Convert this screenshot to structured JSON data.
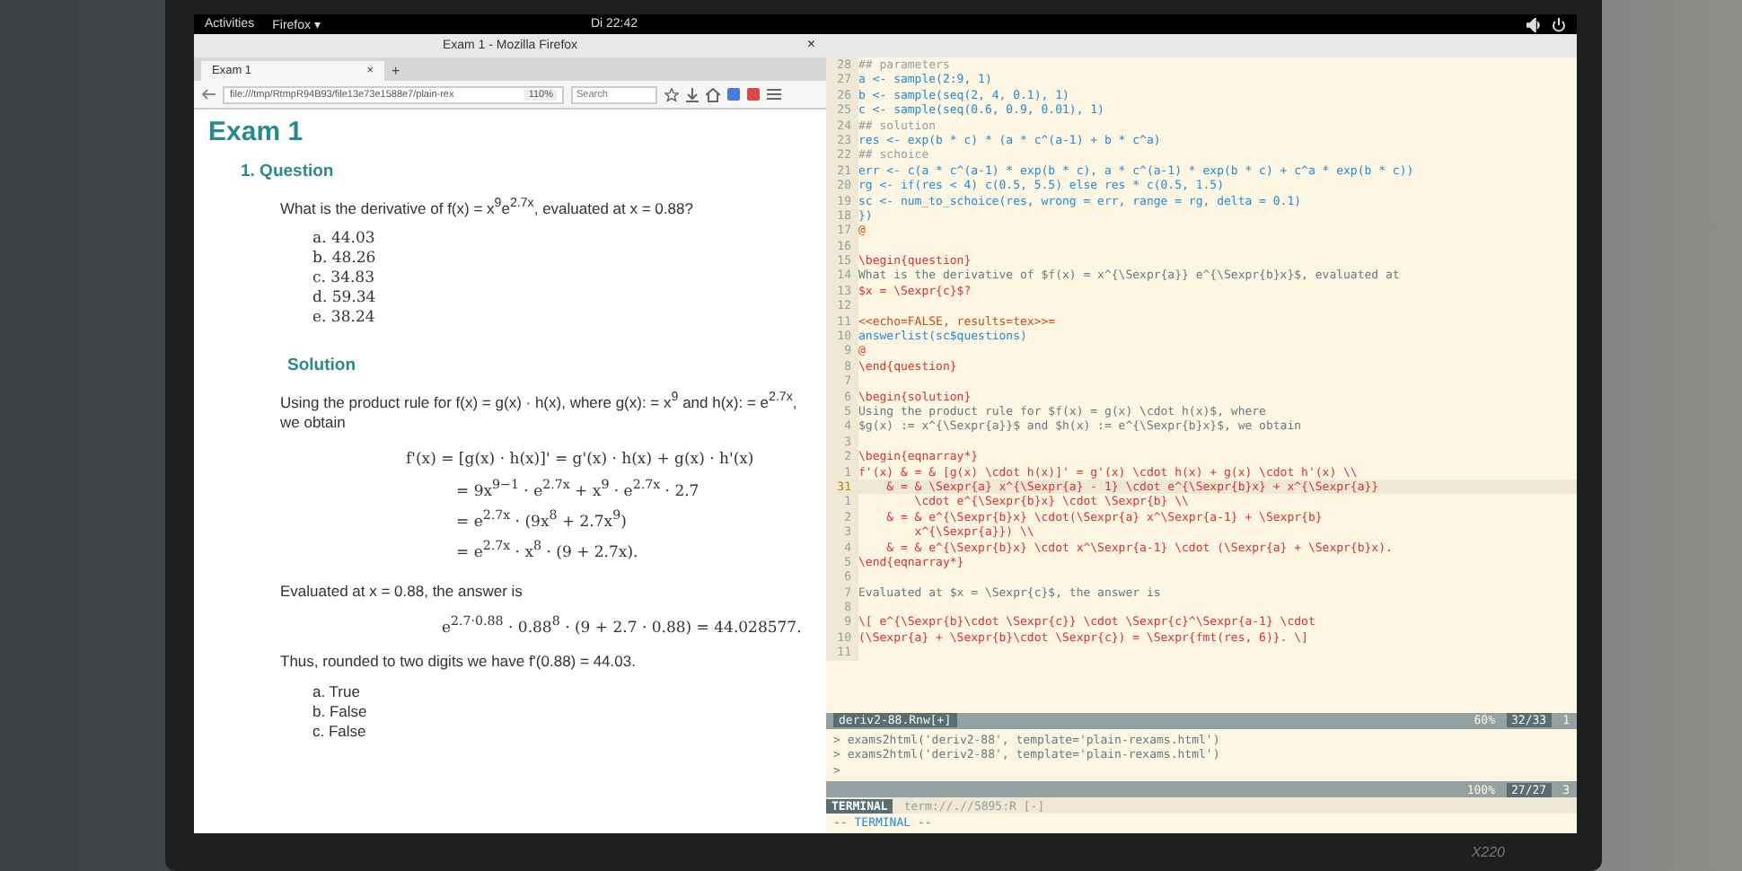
{
  "top_bar": {
    "activities": "Activities",
    "app": "Firefox ▾",
    "clock": "Di 22:42"
  },
  "browser": {
    "title": "Exam 1 - Mozilla Firefox",
    "close": "×",
    "tabs": [
      {
        "label": "Exam 1",
        "selected": true
      }
    ],
    "tab_close": "×",
    "new_tab": "+",
    "url": "file:///tmp/RtmpR94B93/file13e73e1588e7/plain-rex",
    "zoom": "110%",
    "search": {
      "placeholder": "Search"
    }
  },
  "page": {
    "title": "Exam 1",
    "question_heading": "1. Question",
    "question": "What is the derivative of f(x) = x$^{9}$e$^{2.7x}$, evaluated at x = 0.88?",
    "answers": [
      "a. 44.03",
      "b. 48.26",
      "c. 34.83",
      "d. 59.34",
      "e. 38.24"
    ],
    "solution_heading": "Solution",
    "solution_intro": "Using the product rule for f(x) = g(x) · h(x), where g(x): = x$^{9}$ and h(x): = e$^{2.7x}$, we obtain",
    "derivation": [
      "f'(x)  =  [g(x) · h(x)]' = g'(x) · h(x) + g(x) · h'(x)",
      "= 9x$^{9−1}$ · e$^{2.7x}$ + x$^{9}$ · e$^{2.7x}$ · 2.7",
      "= e$^{2.7x}$ · (9x$^{8}$ + 2.7x$^{9}$)",
      "= e$^{2.7x}$ · x$^{8}$ · (9 + 2.7x)."
    ],
    "evaluated": "Evaluated at x = 0.88, the answer is",
    "result": "e$^{2.7·0.88}$ · 0.88$^{8}$ · (9 + 2.7 · 0.88) = 44.028577.",
    "conclusion": "Thus, rounded to two digits we have f'(0.88) = 44.03.",
    "answer_list": [
      "a. True",
      "b. False",
      "c. False"
    ]
  },
  "editor": {
    "lines": [
      {
        "number": "28",
        "text": "## parameters",
        "kind": "comment",
        "current": false
      },
      {
        "number": "27",
        "text": "a <- sample(2:9, 1)",
        "kind": "code",
        "current": false
      },
      {
        "number": "26",
        "text": "b <- sample(seq(2, 4, 0.1), 1)",
        "kind": "code",
        "current": false
      },
      {
        "number": "25",
        "text": "c <- sample(seq(0.6, 0.9, 0.01), 1)",
        "kind": "code",
        "current": false
      },
      {
        "number": "24",
        "text": "## solution",
        "kind": "comment",
        "current": false
      },
      {
        "number": "23",
        "text": "res <- exp(b * c) * (a * c^(a-1) + b * c^a)",
        "kind": "code",
        "current": false
      },
      {
        "number": "22",
        "text": "## schoice",
        "kind": "comment",
        "current": false
      },
      {
        "number": "21",
        "text": "err <- c(a * c^(a-1) * exp(b * c), a * c^(a-1) * exp(b * c) + c^a * exp(b * c))",
        "kind": "code",
        "current": false
      },
      {
        "number": "20",
        "text": "rg <- if(res < 4) c(0.5, 5.5) else res * c(0.5, 1.5)",
        "kind": "code",
        "current": false
      },
      {
        "number": "19",
        "text": "sc <- num_to_schoice(res, wrong = err, range = rg, delta = 0.1)",
        "kind": "code",
        "current": false
      },
      {
        "number": "18",
        "text": "})",
        "kind": "code",
        "current": false
      },
      {
        "number": "17",
        "text": "@",
        "kind": "chunk",
        "current": false
      },
      {
        "number": "16",
        "current": false
      },
      {
        "number": "15",
        "text": "\\begin{question}",
        "kind": "latex",
        "current": false
      },
      {
        "number": "14",
        "text": "What is the derivative of $f(x) = x^{\\Sexpr{a}} e^{\\Sexpr{b}x}$, evaluated at",
        "kind": "text",
        "current": false
      },
      {
        "number": "13",
        "text": "$x = \\Sexpr{c}$?",
        "kind": "latex",
        "current": false
      },
      {
        "number": "12",
        "current": false
      },
      {
        "number": "11",
        "text": "<<echo=FALSE, results=tex>>=",
        "kind": "chunk",
        "current": false
      },
      {
        "number": "10",
        "text": "answerlist(sc$questions)",
        "kind": "code",
        "current": false
      },
      {
        "number": "9",
        "text": "@",
        "kind": "chunk",
        "current": false
      },
      {
        "number": "8",
        "text": "\\end{question}",
        "kind": "latex",
        "current": false
      },
      {
        "number": "7",
        "current": false
      },
      {
        "number": "6",
        "text": "\\begin{solution}",
        "kind": "latex",
        "current": false
      },
      {
        "number": "5",
        "text": "Using the product rule for $f(x) = g(x) \\cdot h(x)$, where",
        "kind": "text",
        "current": false
      },
      {
        "number": "4",
        "text": "$g(x) := x^{\\Sexpr{a}}$ and $h(x) := e^{\\Sexpr{b}x}$, we obtain",
        "kind": "text",
        "current": false
      },
      {
        "number": "3",
        "current": false
      },
      {
        "number": "2",
        "text": "\\begin{eqnarray*}",
        "kind": "latex",
        "current": false
      },
      {
        "number": "1",
        "text": "f'(x) & = & [g(x) \\cdot h(x)]' = g'(x) \\cdot h(x) + g(x) \\cdot h'(x) \\\\",
        "kind": "latex",
        "current": false
      },
      {
        "number": "31",
        "text": "    & = & \\Sexpr{a} x^{\\Sexpr{a} - 1} \\cdot e^{\\Sexpr{b}x} + x^{\\Sexpr{a}}",
        "kind": "latex",
        "current": true
      },
      {
        "number": "1",
        "text": "        \\cdot e^{\\Sexpr{b}x} \\cdot \\Sexpr{b} \\\\",
        "kind": "latex",
        "current": false
      },
      {
        "number": "2",
        "text": "    & = & e^{\\Sexpr{b}x} \\cdot(\\Sexpr{a} x^\\Sexpr{a-1} + \\Sexpr{b}",
        "kind": "latex",
        "current": false
      },
      {
        "number": "3",
        "text": "        x^{\\Sexpr{a}}) \\\\",
        "kind": "latex",
        "current": false
      },
      {
        "number": "4",
        "text": "    & = & e^{\\Sexpr{b}x} \\cdot x^\\Sexpr{a-1} \\cdot (\\Sexpr{a} + \\Sexpr{b}x).",
        "kind": "latex",
        "current": false
      },
      {
        "number": "5",
        "text": "\\end{eqnarray*}",
        "kind": "latex",
        "current": false
      },
      {
        "number": "6",
        "current": false
      },
      {
        "number": "7",
        "text": "Evaluated at $x = \\Sexpr{c}$, the answer is",
        "kind": "text",
        "current": false
      },
      {
        "number": "8",
        "current": false
      },
      {
        "number": "9",
        "text": "\\[ e^{\\Sexpr{b}\\cdot \\Sexpr{c}} \\cdot \\Sexpr{c}^\\Sexpr{a-1} \\cdot",
        "kind": "latex",
        "current": false
      },
      {
        "number": "10",
        "text": "(\\Sexpr{a} + \\Sexpr{b}\\cdot \\Sexpr{c}) = \\Sexpr{fmt(res, 6)}. \\]",
        "kind": "latex",
        "current": false
      },
      {
        "number": "11",
        "current": false
      }
    ],
    "status": {
      "file": "deriv2-88.Rnw[+]",
      "percent": "60%",
      "position": "32/33",
      "column": "1"
    },
    "terminal_lines": [
      "> exams2html('deriv2-88', template='plain-rexams.html')",
      "> exams2html('deriv2-88', template='plain-rexams.html')",
      ">"
    ],
    "terminal_status": {
      "percent": "100%",
      "position": "27/27",
      "column": "3"
    },
    "terminal_tab": {
      "label": "TERMINAL",
      "name": "term://.//5895:R [-]"
    },
    "mode": "-- TERMINAL --"
  },
  "laptop_model": "X220"
}
